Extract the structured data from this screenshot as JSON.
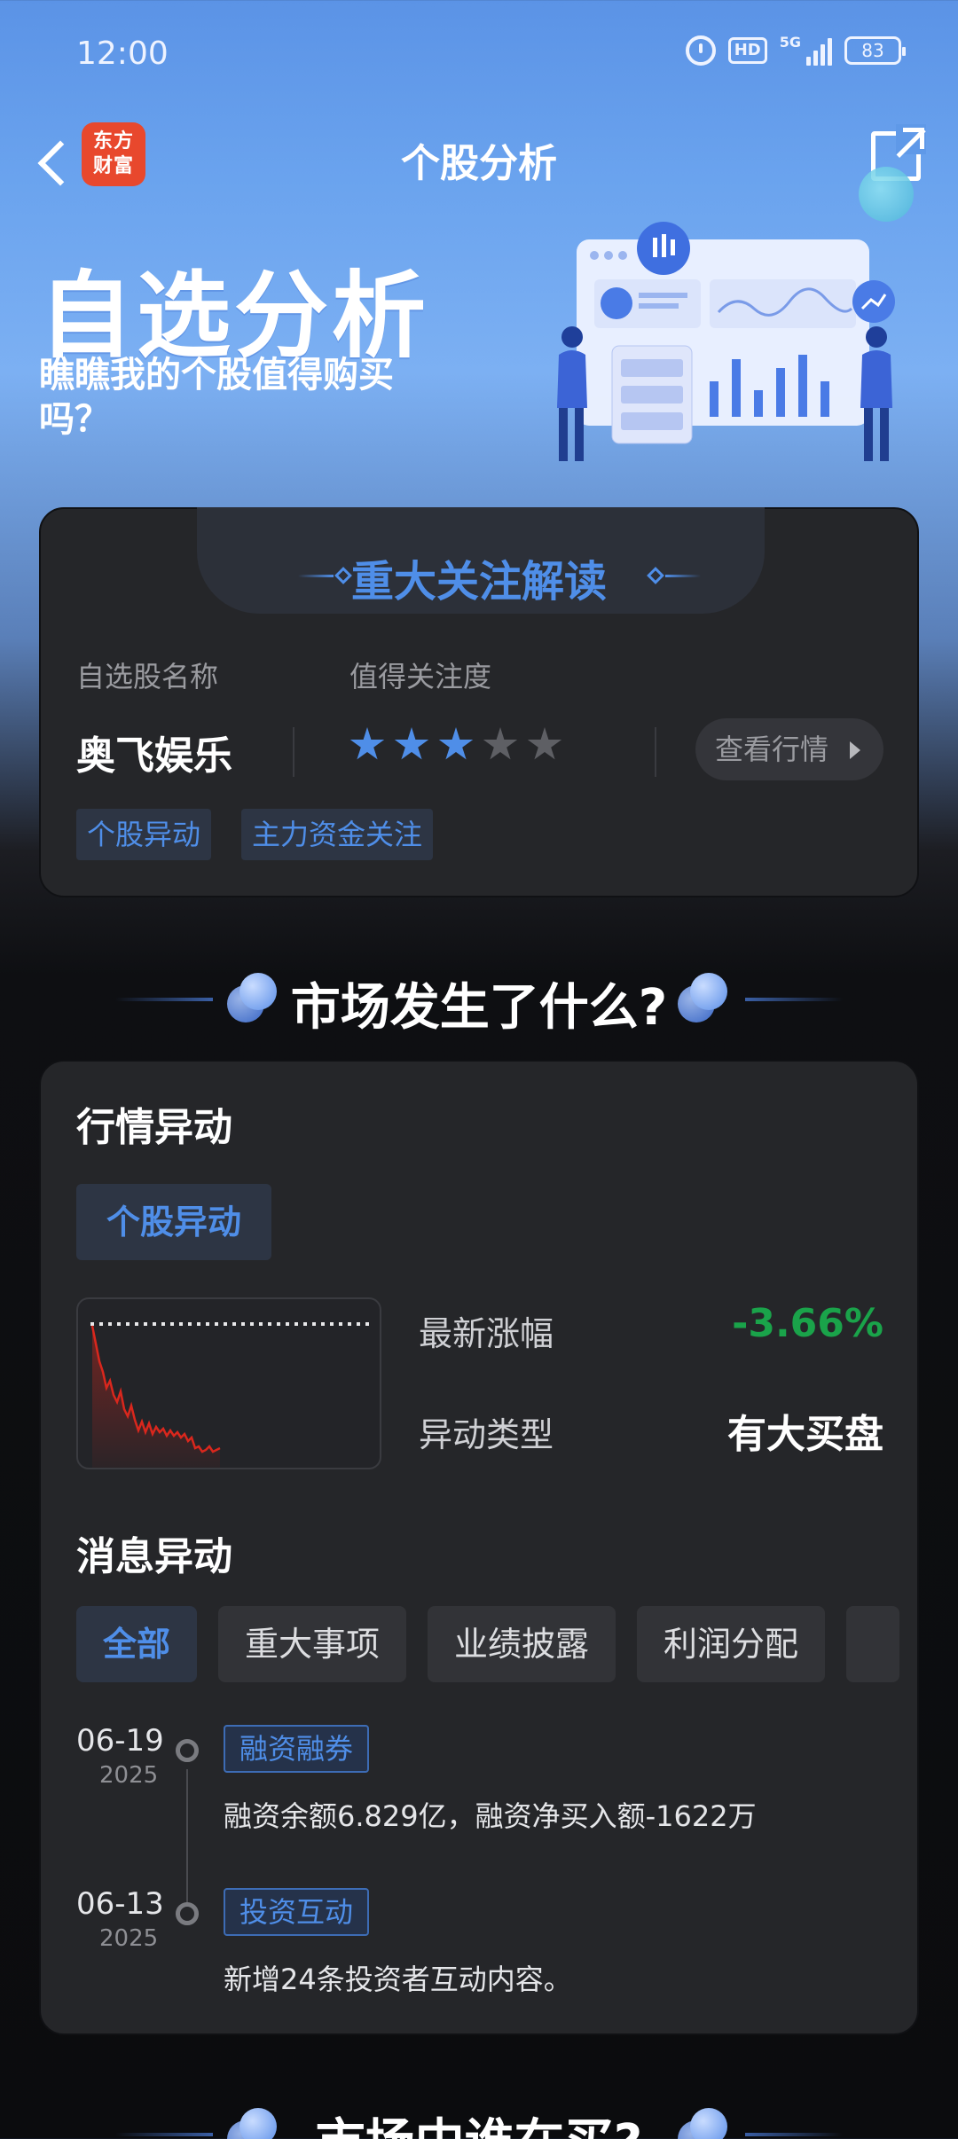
{
  "status_bar": {
    "time": "12:00",
    "hd": "HD",
    "network": "5G",
    "battery": "83"
  },
  "nav": {
    "logo_line1": "东方",
    "logo_line2": "财富",
    "title": "个股分析"
  },
  "hero": {
    "title": "自选分析",
    "subtitle": "瞧瞧我的个股值得购买吗？"
  },
  "focus_card": {
    "title": "重大关注解读",
    "name_header": "自选股名称",
    "attention_header": "值得关注度",
    "stock_name": "奥飞娱乐",
    "rating": 3,
    "rating_max": 5,
    "quote_button": "查看行情",
    "tags": [
      "个股异动",
      "主力资金关注"
    ]
  },
  "market_section": {
    "title": "市场发生了什么?"
  },
  "market_card": {
    "anomaly_title": "行情异动",
    "anomaly_tab": "个股异动",
    "latest_change_label": "最新涨幅",
    "latest_change_value": "-3.66%",
    "anomaly_type_label": "异动类型",
    "anomaly_type_value": "有大买盘",
    "news_title": "消息异动",
    "filters": [
      "全部",
      "重大事项",
      "业绩披露",
      "利润分配"
    ],
    "timeline": [
      {
        "date": "06-19",
        "year": "2025",
        "tag": "融资融券",
        "text": "融资余额6.829亿，融资净买入额-1622万"
      },
      {
        "date": "06-13",
        "year": "2025",
        "tag": "投资互动",
        "text": "新增24条投资者互动内容。"
      }
    ]
  },
  "next_section": {
    "title": "市场中谁在买?"
  },
  "colors": {
    "accent": "#4f8ee8",
    "down_green": "#1aa34a",
    "card_bg": "#252629",
    "logo_red": "#e8482d"
  }
}
